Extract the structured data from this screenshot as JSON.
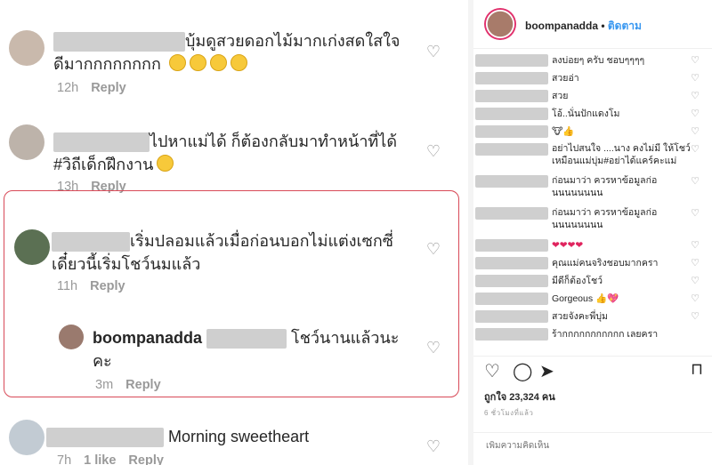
{
  "left_comments": [
    {
      "line1": "บุ้มดูสวยดอกไม้มากเก่งสดใสใจ",
      "line2": "ดีมากกกกกกกก",
      "time": "12h",
      "reply": "Reply"
    },
    {
      "line1": "ไปหาแม่ได้ ก็ต้องกลับมาทำหน้าที่ได้",
      "line2": "#วิถีเด็กฝึกงาน",
      "time": "13h",
      "reply": "Reply"
    },
    {
      "line1": "เริ่มปลอมแล้วเมื่อก่อนบอกไม่แต่งเซกซี่",
      "line2": "เดี๋ยวนี้เริ่มโชว์นมแล้ว",
      "time": "11h",
      "reply": "Reply"
    },
    {
      "username": "boompanadda",
      "line1": "โชว์นานแล้วนะ",
      "line2": "คะ",
      "time": "3m",
      "reply": "Reply"
    },
    {
      "line1": "Morning sweetheart",
      "time": "7h",
      "likes": "1 like",
      "reply": "Reply"
    }
  ],
  "post": {
    "username": "boompanadda",
    "separator": " • ",
    "follow": "ติดตาม",
    "comments": [
      {
        "text": "ลงบ่อยๆ ครับ ชอบๆๆๆๆ"
      },
      {
        "text": "สวยอ่า"
      },
      {
        "text": "สวย"
      },
      {
        "text": "โอ้..นั่นปักแดงโม"
      },
      {
        "text": "🐮👍"
      },
      {
        "text": "อย่าไปสนใจ ....นาง คงไม่มี ให้โชว์เหมือนแม่บุ่ม#อย่าได้แคร์คะแม่"
      },
      {
        "text": "ก่อนมาว่า ควรหาข้อมูลก่อ นนนนนนนน"
      },
      {
        "text": "ก่อนมาว่า ควรหาข้อมูลก่อ นนนนนนนน"
      },
      {
        "text": "❤❤❤❤"
      },
      {
        "text": "คุณแม่คนจริงชอบมากครา"
      },
      {
        "text": "มีดีก็ต้องโชว์"
      },
      {
        "text": "Gorgeous 👍💖"
      },
      {
        "text": "สวยจังคะพี่บุ่ม"
      },
      {
        "text": "ร้ากกกกกกกกกกก เลยครา"
      }
    ],
    "likes_label": "ถูกใจ 23,324 คน",
    "time_ago": "6 ชั่วโมงที่แล้ว",
    "add_comment_placeholder": "เพิ่มความคิดเห็น"
  },
  "icons": {
    "heart": "heart-outline-icon",
    "comment": "comment-icon",
    "bookmark": "bookmark-icon"
  },
  "colors": {
    "highlight_border": "#d84a58",
    "follow_link": "#3897f0",
    "meta_gray": "#999999"
  }
}
